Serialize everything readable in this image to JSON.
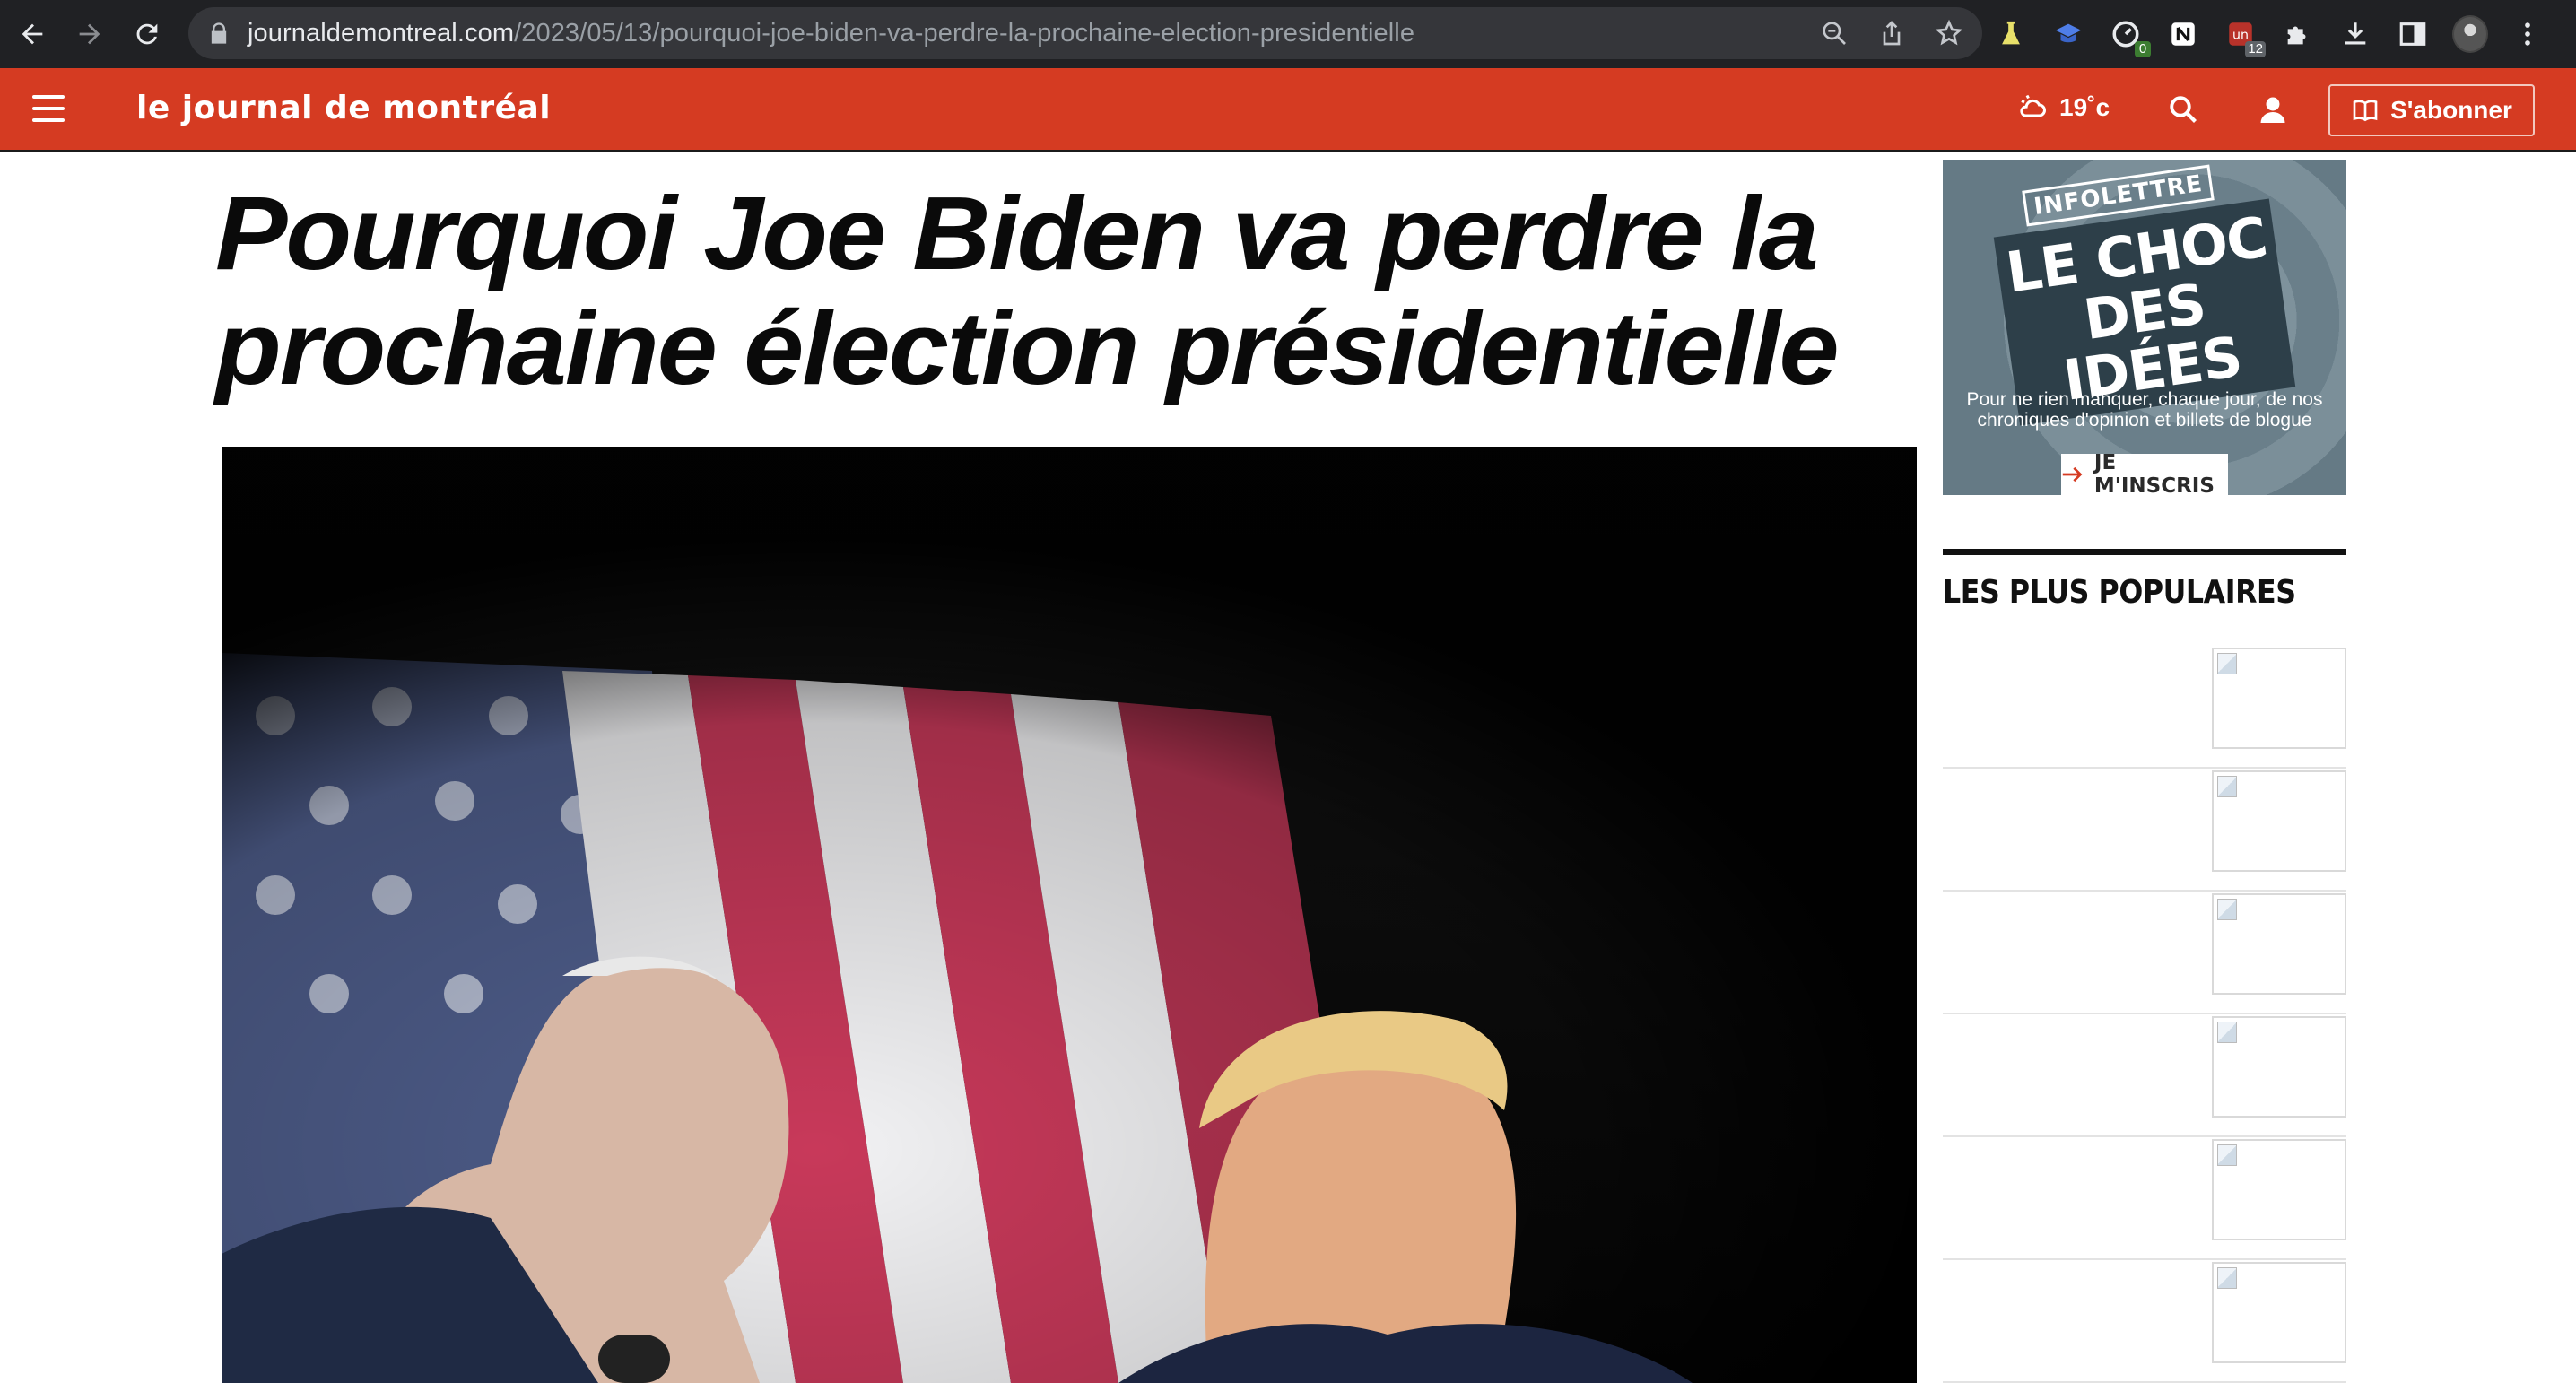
{
  "browser": {
    "url_host": "journaldemontreal.com",
    "url_path": "/2023/05/13/pourquoi-joe-biden-va-perdre-la-prochaine-election-presidentielle",
    "extensions": [
      {
        "name": "flask-icon",
        "badge": ""
      },
      {
        "name": "hat-icon",
        "badge": ""
      },
      {
        "name": "gauge-icon",
        "badge": "0"
      },
      {
        "name": "notion-icon",
        "badge": ""
      },
      {
        "name": "un-icon",
        "badge": "12"
      },
      {
        "name": "puzzle-icon",
        "badge": ""
      },
      {
        "name": "download-icon",
        "badge": ""
      },
      {
        "name": "sidepanel-icon",
        "badge": ""
      }
    ]
  },
  "header": {
    "logo": "le journal de montréal",
    "weather": "19˚c",
    "subscribe_label": "S'abonner",
    "brand_color": "#d53b22"
  },
  "article": {
    "headline": "Pourquoi Joe Biden va perdre la prochaine élection présidentielle"
  },
  "sidebar": {
    "promo": {
      "badge": "INFOLETTRE",
      "title_line1": "LE CHOC",
      "title_line2": "DES IDÉES",
      "text": "Pour ne rien manquer, chaque jour, de nos chroniques d'opinion et billets de blogue",
      "cta": "JE M'INSCRIS"
    },
    "popular_title": "LES PLUS POPULAIRES",
    "popular_items_count": 6
  }
}
